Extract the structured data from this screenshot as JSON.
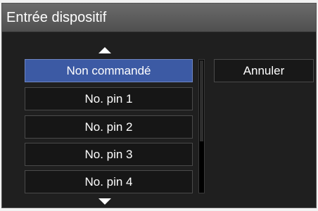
{
  "dialog": {
    "title": "Entrée dispositif"
  },
  "list": {
    "items": [
      {
        "label": "Non commandé",
        "selected": true
      },
      {
        "label": "No. pin 1",
        "selected": false
      },
      {
        "label": "No. pin 2",
        "selected": false
      },
      {
        "label": "No. pin 3",
        "selected": false
      },
      {
        "label": "No. pin 4",
        "selected": false
      }
    ],
    "scroll_up_icon": "triangle-up-icon",
    "scroll_down_icon": "triangle-down-icon"
  },
  "buttons": {
    "cancel_label": "Annuler"
  },
  "colors": {
    "selected": "#3c5aa4",
    "background": "#1f1f1f",
    "titlebar": "#5c5c5c"
  }
}
